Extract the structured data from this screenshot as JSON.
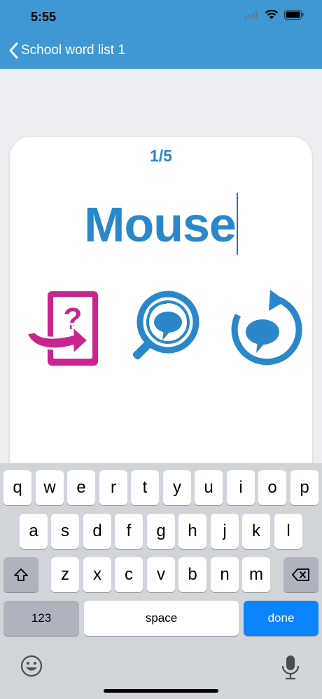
{
  "status_bar": {
    "time": "5:55"
  },
  "nav": {
    "back_label": "School word list 1"
  },
  "card": {
    "counter": "1/5",
    "word": "Mouse",
    "actions": [
      {
        "name": "quiz-exit-icon"
      },
      {
        "name": "search-speech-icon"
      },
      {
        "name": "replay-speech-icon"
      }
    ]
  },
  "keyboard": {
    "row1": [
      "q",
      "w",
      "e",
      "r",
      "t",
      "y",
      "u",
      "i",
      "o",
      "p"
    ],
    "row2": [
      "a",
      "s",
      "d",
      "f",
      "g",
      "h",
      "j",
      "k",
      "l"
    ],
    "row3": [
      "z",
      "x",
      "c",
      "v",
      "b",
      "n",
      "m"
    ],
    "numbers_label": "123",
    "space_label": "space",
    "done_label": "done"
  },
  "colors": {
    "header": "#3f97d3",
    "accent_blue": "#2a87c9",
    "accent_magenta": "#c8268e",
    "done_key": "#0a84ff"
  }
}
